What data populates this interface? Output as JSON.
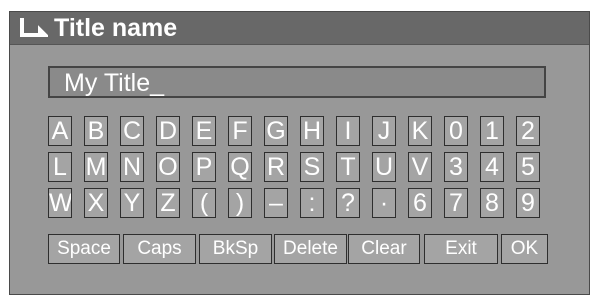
{
  "dialog": {
    "title": "Title name",
    "icon": "return-arrow-icon"
  },
  "input": {
    "value": "My Title_"
  },
  "keyboard": {
    "rows": [
      [
        "A",
        "B",
        "C",
        "D",
        "E",
        "F",
        "G",
        "H",
        "I",
        "J",
        "K",
        "0",
        "1",
        "2"
      ],
      [
        "L",
        "M",
        "N",
        "O",
        "P",
        "Q",
        "R",
        "S",
        "T",
        "U",
        "V",
        "3",
        "4",
        "5"
      ],
      [
        "W",
        "X",
        "Y",
        "Z",
        "(",
        ")",
        "–",
        ":",
        "?",
        "·",
        "6",
        "7",
        "8",
        "9"
      ]
    ],
    "functions": [
      "Space",
      "Caps",
      "BkSp",
      "Delete",
      "Clear",
      "Exit",
      "OK"
    ]
  },
  "colors": {
    "panel_bg": "#989898",
    "titlebar_bg": "#686868",
    "key_bg": "#a4a4a4",
    "key_text": "#ffffff"
  }
}
